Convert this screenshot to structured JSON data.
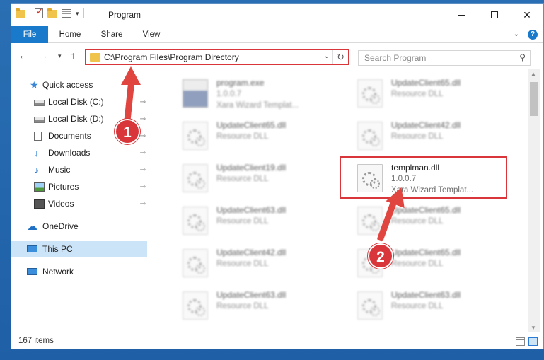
{
  "window": {
    "title": "Program",
    "minimize_glyph": "—",
    "maximize_glyph": "☐",
    "close_glyph": "✕"
  },
  "ribbon": {
    "tabs": [
      "File",
      "Home",
      "Share",
      "View"
    ],
    "expand_glyph": "⌄",
    "help_glyph": "?"
  },
  "address_bar": {
    "back_glyph": "←",
    "forward_glyph": "→",
    "recent_glyph": "▾",
    "up_glyph": "↑",
    "path": "C:\\Program Files\\Program Directory",
    "dropdown_glyph": "⌄",
    "refresh_glyph": "↻"
  },
  "search": {
    "placeholder": "Search Program",
    "icon_glyph": "⚲"
  },
  "nav_pane": {
    "items": [
      {
        "label": "Quick access",
        "icon": "star-icon",
        "glyph": "★",
        "pinned": false
      },
      {
        "label": "Local Disk (C:)",
        "icon": "disk-icon",
        "glyph": "",
        "pinned": true
      },
      {
        "label": "Local Disk (D:)",
        "icon": "disk-icon",
        "glyph": "",
        "pinned": true
      },
      {
        "label": "Documents",
        "icon": "documents-icon",
        "glyph": "",
        "pinned": true
      },
      {
        "label": "Downloads",
        "icon": "download-icon",
        "glyph": "↓",
        "pinned": true
      },
      {
        "label": "Music",
        "icon": "music-icon",
        "glyph": "♪",
        "pinned": true
      },
      {
        "label": "Pictures",
        "icon": "pictures-icon",
        "glyph": "",
        "pinned": true
      },
      {
        "label": "Videos",
        "icon": "videos-icon",
        "glyph": "",
        "pinned": true
      },
      {
        "label": "OneDrive",
        "icon": "cloud-icon",
        "glyph": "☁",
        "pinned": false
      },
      {
        "label": "This PC",
        "icon": "computer-icon",
        "glyph": "",
        "pinned": false,
        "selected": true
      },
      {
        "label": "Network",
        "icon": "network-icon",
        "glyph": "",
        "pinned": false
      }
    ],
    "pin_glyph": "📌"
  },
  "files": [
    {
      "name": "program.exe",
      "version": "1.0.0.7",
      "description": "Xara Wizard Templat...",
      "type": "exe",
      "blurred": true
    },
    {
      "name": "UpdateClient65.dll",
      "version": "Resource DLL",
      "description": "",
      "type": "dll",
      "blurred": true
    },
    {
      "name": "UpdateClient65.dll",
      "version": "Resource DLL",
      "description": "",
      "type": "dll",
      "blurred": true
    },
    {
      "name": "UpdateClient42.dll",
      "version": "Resource DLL",
      "description": "",
      "type": "dll",
      "blurred": true
    },
    {
      "name": "UpdateClient19.dll",
      "version": "Resource DLL",
      "description": "",
      "type": "dll",
      "blurred": true
    },
    {
      "name": "templman.dll",
      "version": "1.0.0.7",
      "description": "Xara Wizard Templat...",
      "type": "dll",
      "blurred": false
    },
    {
      "name": "UpdateClient63.dll",
      "version": "Resource DLL",
      "description": "",
      "type": "dll",
      "blurred": true
    },
    {
      "name": "UpdateClient65.dll",
      "version": "Resource DLL",
      "description": "",
      "type": "dll",
      "blurred": true
    },
    {
      "name": "UpdateClient42.dll",
      "version": "Resource DLL",
      "description": "",
      "type": "dll",
      "blurred": true
    },
    {
      "name": "UpdateClient65.dll",
      "version": "Resource DLL",
      "description": "",
      "type": "dll",
      "blurred": true
    },
    {
      "name": "UpdateClient63.dll",
      "version": "Resource DLL",
      "description": "",
      "type": "dll",
      "blurred": true
    },
    {
      "name": "UpdateClient63.dll",
      "version": "Resource DLL",
      "description": "",
      "type": "dll",
      "blurred": true
    }
  ],
  "scrollbar": {
    "up_glyph": "▲",
    "down_glyph": "▼"
  },
  "status": {
    "item_count": "167 items"
  },
  "annotations": {
    "step1": "1",
    "step2": "2"
  },
  "colors": {
    "accent": "#1979ca",
    "highlight_red": "#d8363a",
    "selected_bg": "#cce4f7"
  }
}
